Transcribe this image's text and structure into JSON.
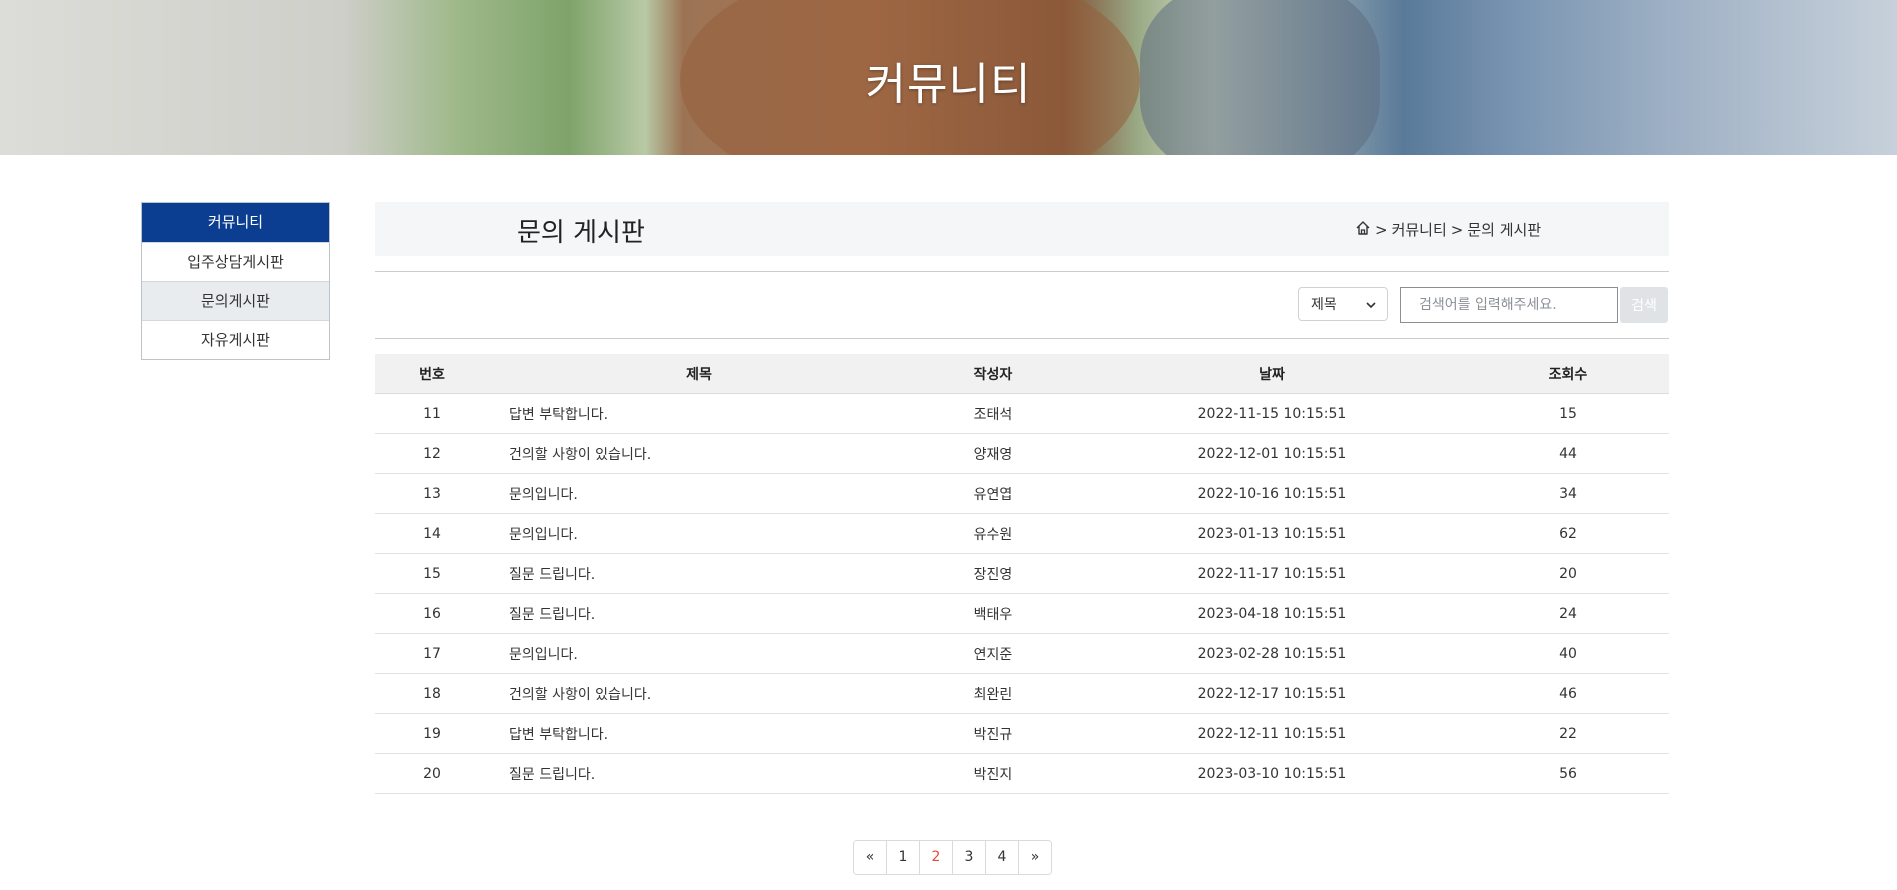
{
  "banner": {
    "title": "커뮤니티"
  },
  "sidebar": {
    "header": "커뮤니티",
    "items": [
      {
        "label": "입주상담게시판",
        "active": false
      },
      {
        "label": "문의게시판",
        "active": true
      },
      {
        "label": "자유게시판",
        "active": false
      }
    ]
  },
  "page": {
    "title": "문의 게시판",
    "breadcrumb": {
      "icon": "home-icon",
      "level1": "커뮤니티",
      "level2": "문의 게시판",
      "separator": ">"
    }
  },
  "search": {
    "field_selected": "제목",
    "placeholder": "검색어를 입력해주세요.",
    "button_label": "검색"
  },
  "table": {
    "headers": [
      "번호",
      "제목",
      "작성자",
      "날짜",
      "조회수"
    ],
    "rows": [
      [
        "11",
        "답변 부탁합니다.",
        "조태석",
        "2022-11-15 10:15:51",
        "15"
      ],
      [
        "12",
        "건의할 사항이 있습니다.",
        "양재영",
        "2022-12-01 10:15:51",
        "44"
      ],
      [
        "13",
        "문의입니다.",
        "유연엽",
        "2022-10-16 10:15:51",
        "34"
      ],
      [
        "14",
        "문의입니다.",
        "유수원",
        "2023-01-13 10:15:51",
        "62"
      ],
      [
        "15",
        "질문 드립니다.",
        "장진영",
        "2022-11-17 10:15:51",
        "20"
      ],
      [
        "16",
        "질문 드립니다.",
        "백태우",
        "2023-04-18 10:15:51",
        "24"
      ],
      [
        "17",
        "문의입니다.",
        "연지준",
        "2023-02-28 10:15:51",
        "40"
      ],
      [
        "18",
        "건의할 사항이 있습니다.",
        "최완린",
        "2022-12-17 10:15:51",
        "46"
      ],
      [
        "19",
        "답변 부탁합니다.",
        "박진규",
        "2022-12-11 10:15:51",
        "22"
      ],
      [
        "20",
        "질문 드립니다.",
        "박진지",
        "2023-03-10 10:15:51",
        "56"
      ]
    ]
  },
  "pagination": {
    "prev": "«",
    "pages": [
      "1",
      "2",
      "3",
      "4"
    ],
    "current": "2",
    "next": "»"
  },
  "colors": {
    "sidebar_header_bg": "#0b3d91",
    "current_page": "#e84a3c"
  }
}
